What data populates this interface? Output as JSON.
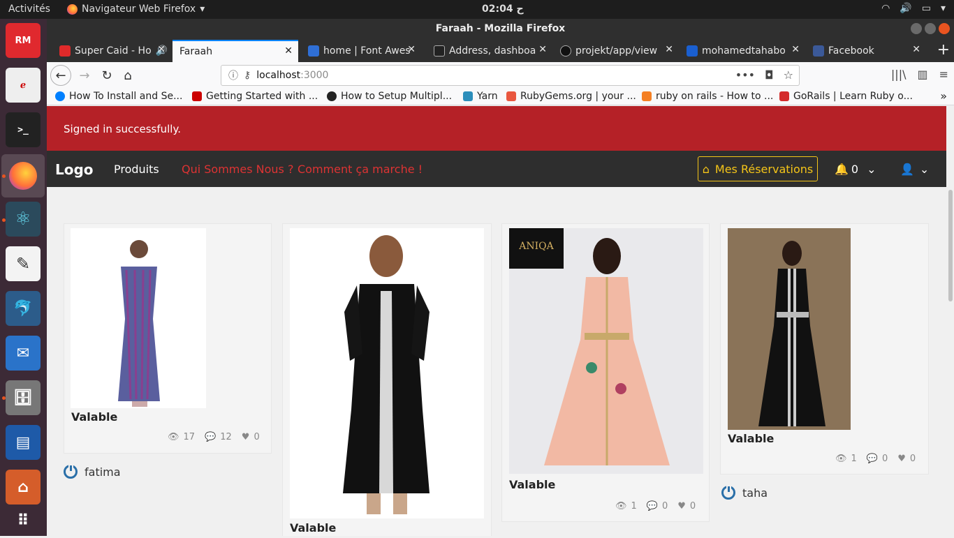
{
  "system": {
    "activities": "Activités",
    "app_name": "Navigateur Web Firefox",
    "clock": "ح 02:04"
  },
  "window": {
    "title": "Faraah - Mozilla Firefox"
  },
  "tabs": [
    {
      "label": "Super Caid - Ho",
      "color": "#e02a2a"
    },
    {
      "label": "Faraah",
      "color": ""
    },
    {
      "label": "home | Font Awes",
      "color": "#2f6fd6"
    },
    {
      "label": "Address, dashboa",
      "color": "#222222"
    },
    {
      "label": "projekt/app/view",
      "color": "#111111"
    },
    {
      "label": "mohamedtahabo",
      "color": "#1a5fd0"
    },
    {
      "label": "Facebook",
      "color": "#3b5998"
    }
  ],
  "urlbar": {
    "host": "localhost",
    "port": ":3000"
  },
  "bookmarks": [
    {
      "label": "How To Install and Se...",
      "color": "#0080ff"
    },
    {
      "label": "Getting Started with ...",
      "color": "#cc0000"
    },
    {
      "label": "How to Setup Multipl...",
      "color": "#222222"
    },
    {
      "label": "Yarn",
      "color": "#2c8ebb"
    },
    {
      "label": "RubyGems.org | your ...",
      "color": "#e9573f"
    },
    {
      "label": "ruby on rails - How to ...",
      "color": "#f48024"
    },
    {
      "label": "GoRails | Learn Ruby o...",
      "color": "#d42b2b"
    }
  ],
  "flash": "Signed in successfully.",
  "nav": {
    "logo": "Logo",
    "produits": "Produits",
    "qui": "Qui Sommes Nous ?",
    "comment": "Comment ça marche !",
    "reservations": "Mes Réservations",
    "notif_count": "0"
  },
  "colors": {
    "flash_bg": "#b52127",
    "accent": "#f5c518",
    "link_red": "#d33",
    "nav_bg": "#2e2e2e"
  },
  "cards": [
    {
      "title": "Valable",
      "views": "17",
      "comments": "12",
      "likes": "0",
      "owner": "fatima"
    },
    {
      "title": "Valable",
      "views": "",
      "comments": "",
      "likes": "",
      "owner": ""
    },
    {
      "title": "Valable",
      "views": "1",
      "comments": "0",
      "likes": "0",
      "owner": ""
    },
    {
      "title": "Valable",
      "views": "1",
      "comments": "0",
      "likes": "0",
      "owner": "taha"
    }
  ],
  "logo_badge": "ANIQA"
}
